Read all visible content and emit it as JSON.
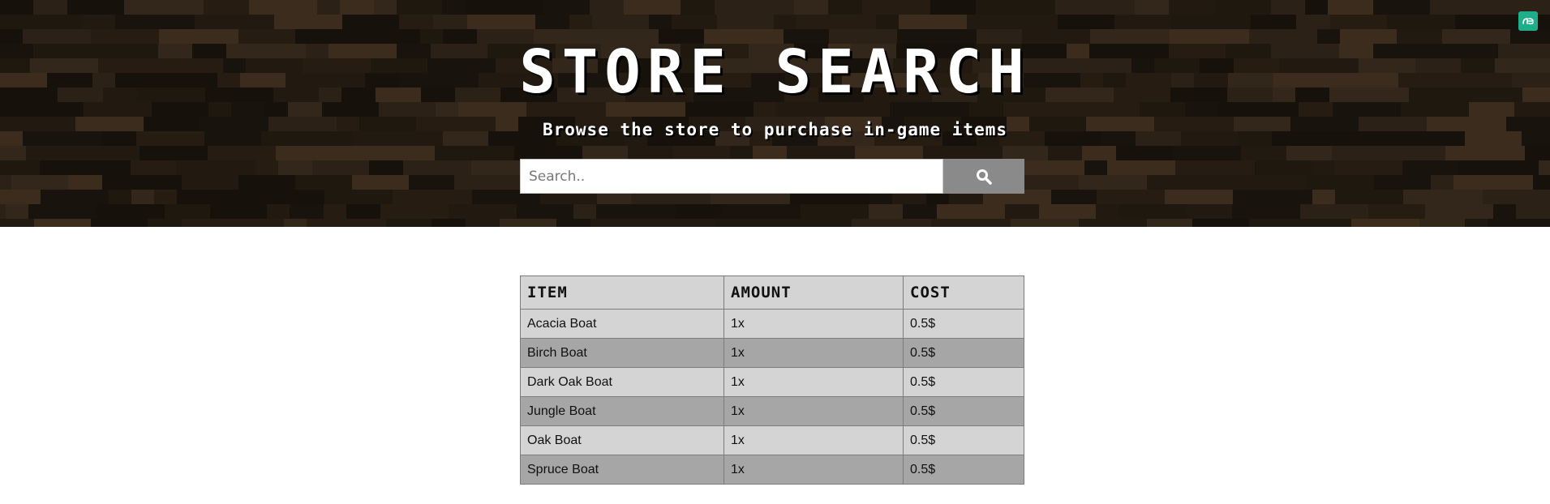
{
  "hero": {
    "title": "Store Search",
    "subtitle": "Browse the store to purchase in-game items"
  },
  "search": {
    "value": "",
    "placeholder": "Search..",
    "button_icon": "search-icon"
  },
  "corner_badge": {
    "icon": "ae-icon",
    "text": "æ"
  },
  "table": {
    "headers": [
      "Item",
      "Amount",
      "Cost"
    ],
    "rows": [
      {
        "item": "Acacia Boat",
        "amount": "1x",
        "cost": "0.5$"
      },
      {
        "item": "Birch Boat",
        "amount": "1x",
        "cost": "0.5$"
      },
      {
        "item": "Dark Oak Boat",
        "amount": "1x",
        "cost": "0.5$"
      },
      {
        "item": "Jungle Boat",
        "amount": "1x",
        "cost": "0.5$"
      },
      {
        "item": "Oak Boat",
        "amount": "1x",
        "cost": "0.5$"
      },
      {
        "item": "Spruce Boat",
        "amount": "1x",
        "cost": "0.5$"
      }
    ]
  },
  "colors": {
    "hero_dark": "#1f180f",
    "row_light": "#d4d4d4",
    "row_dark": "#a6a6a6",
    "search_button": "#8a8a8a",
    "badge": "#1fae8a"
  }
}
